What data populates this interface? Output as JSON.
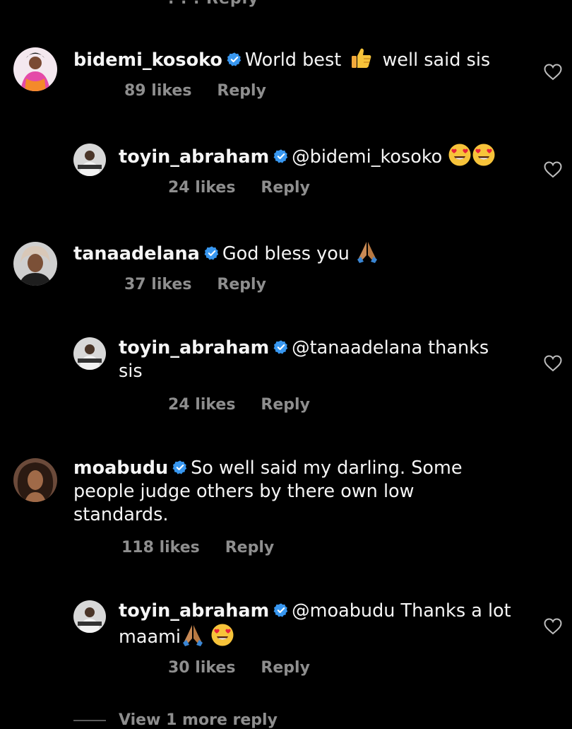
{
  "top_partial": ". . .  Reply",
  "comments": [
    {
      "username": "bidemi_kosoko",
      "text_before": "World best",
      "text_after": "well said sis",
      "likes": "89 likes",
      "reply": "Reply"
    },
    {
      "username": "toyin_abraham",
      "text": "@bidemi_kosoko",
      "likes": "24 likes",
      "reply": "Reply"
    },
    {
      "username": "tanaadelana",
      "text": "God bless you",
      "likes": "37 likes",
      "reply": "Reply"
    },
    {
      "username": "toyin_abraham",
      "text": "@tanaadelana thanks sis",
      "likes": "24 likes",
      "reply": "Reply"
    },
    {
      "username": "moabudu",
      "text": "So well said my darling. Some people judge others by there own low standards.",
      "likes": "118 likes",
      "reply": "Reply"
    },
    {
      "username": "toyin_abraham",
      "text": "@moabudu Thanks a lot maami",
      "likes": "30 likes",
      "reply": "Reply"
    }
  ],
  "view_more": "View 1 more reply",
  "colors": {
    "background": "#000000",
    "text": "#f5f5f5",
    "muted": "#8e8e8e",
    "verified": "#3897f0"
  }
}
